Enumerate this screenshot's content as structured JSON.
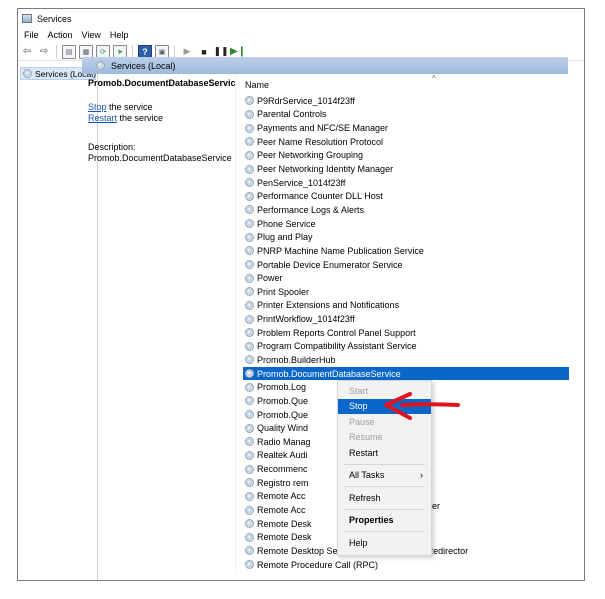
{
  "window": {
    "title": "Services"
  },
  "menubar": {
    "items": [
      "File",
      "Action",
      "View",
      "Help"
    ]
  },
  "toolbar": {
    "icons": [
      "back-arrow-icon",
      "forward-arrow-icon",
      "show-hide-tree-icon",
      "properties-icon",
      "refresh-icon",
      "export-list-icon",
      "help-icon",
      "console-icon",
      "start-service-icon",
      "stop-service-icon",
      "pause-service-icon",
      "restart-service-icon"
    ]
  },
  "tree": {
    "root_label": "Services (Local)"
  },
  "header": {
    "title": "Services (Local)"
  },
  "description_pane": {
    "service_name": "Promob.DocumentDatabaseService",
    "stop_link": "Stop",
    "stop_suffix": " the service",
    "restart_link": "Restart",
    "restart_suffix": " the service",
    "description_label": "Description:",
    "description_text": "Promob.DocumentDatabaseService"
  },
  "list": {
    "column_name": "Name",
    "sort_indicator": "^",
    "rows": [
      {
        "name": "P9RdrService_1014f23ff",
        "selected": false
      },
      {
        "name": "Parental Controls",
        "selected": false
      },
      {
        "name": "Payments and NFC/SE Manager",
        "selected": false
      },
      {
        "name": "Peer Name Resolution Protocol",
        "selected": false
      },
      {
        "name": "Peer Networking Grouping",
        "selected": false
      },
      {
        "name": "Peer Networking Identity Manager",
        "selected": false
      },
      {
        "name": "PenService_1014f23ff",
        "selected": false
      },
      {
        "name": "Performance Counter DLL Host",
        "selected": false
      },
      {
        "name": "Performance Logs & Alerts",
        "selected": false
      },
      {
        "name": "Phone Service",
        "selected": false
      },
      {
        "name": "Plug and Play",
        "selected": false
      },
      {
        "name": "PNRP Machine Name Publication Service",
        "selected": false
      },
      {
        "name": "Portable Device Enumerator Service",
        "selected": false
      },
      {
        "name": "Power",
        "selected": false
      },
      {
        "name": "Print Spooler",
        "selected": false
      },
      {
        "name": "Printer Extensions and Notifications",
        "selected": false
      },
      {
        "name": "PrintWorkflow_1014f23ff",
        "selected": false
      },
      {
        "name": "Problem Reports Control Panel Support",
        "selected": false
      },
      {
        "name": "Program Compatibility Assistant Service",
        "selected": false
      },
      {
        "name": "Promob.BuilderHub",
        "selected": false
      },
      {
        "name": "Promob.DocumentDatabaseService",
        "selected": true
      },
      {
        "name": "Promob.Log",
        "selected": false
      },
      {
        "name": "Promob.Que",
        "selected": false
      },
      {
        "name": "Promob.Que",
        "selected": false
      },
      {
        "name": "Quality Wind",
        "selected": false
      },
      {
        "name": "Radio Manag",
        "selected": false
      },
      {
        "name": "Realtek Audi",
        "selected": false
      },
      {
        "name": "Recommenc",
        "selected": false
      },
      {
        "name": "Registro rem",
        "selected": false
      },
      {
        "name": "Remote Acc",
        "selected": false
      },
      {
        "name": "Remote Acc",
        "selected": false
      },
      {
        "name": "Remote Desk",
        "selected": false
      },
      {
        "name": "Remote Desk",
        "selected": false
      },
      {
        "name": "Remote Desktop Services UserMode Port Redirector",
        "selected": false
      },
      {
        "name": "Remote Procedure Call (RPC)",
        "selected": false
      }
    ],
    "row_remainder_visible": {
      "row_index": 29,
      "text": "er"
    }
  },
  "context_menu": {
    "items": [
      {
        "label": "Start",
        "state": "disabled"
      },
      {
        "label": "Stop",
        "state": "highlighted"
      },
      {
        "label": "Pause",
        "state": "disabled"
      },
      {
        "label": "Resume",
        "state": "disabled"
      },
      {
        "label": "Restart",
        "state": "normal"
      },
      {
        "separator": true
      },
      {
        "label": "All Tasks",
        "state": "normal",
        "submenu": true
      },
      {
        "separator": true
      },
      {
        "label": "Refresh",
        "state": "normal"
      },
      {
        "separator": true
      },
      {
        "label": "Properties",
        "state": "bold"
      },
      {
        "separator": true
      },
      {
        "label": "Help",
        "state": "normal"
      }
    ]
  },
  "colors": {
    "selection": "#0a67c9",
    "header_strip": "#bcd0ea",
    "annotation_arrow": "#e0141e",
    "link": "#1a55b8"
  }
}
